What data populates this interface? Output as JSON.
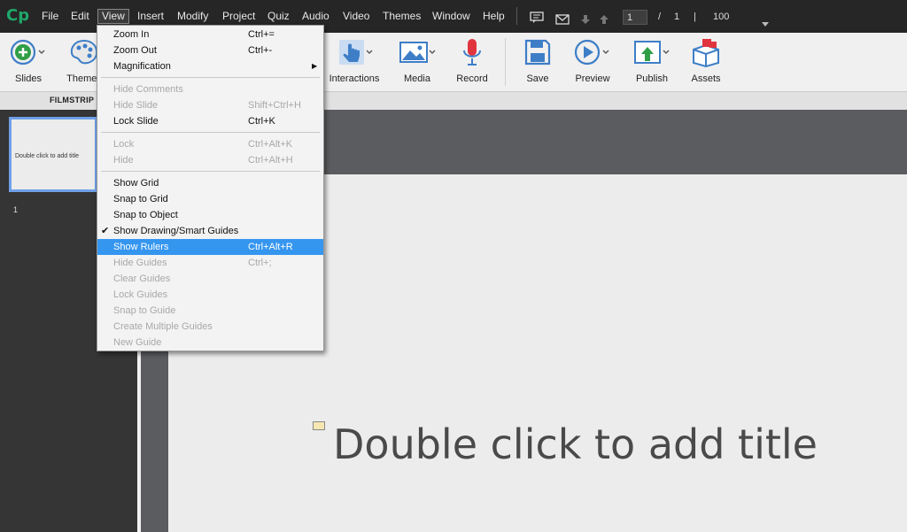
{
  "app": {
    "logo": "Cp"
  },
  "menubar": {
    "items": [
      "File",
      "Edit",
      "View",
      "Insert",
      "Modify",
      "Project",
      "Quiz",
      "Audio",
      "Video",
      "Themes",
      "Window",
      "Help"
    ],
    "page_current": "1",
    "page_separator": "/",
    "page_total": "1",
    "zoom_separator": "|",
    "zoom": "100"
  },
  "toolbar": {
    "slides": "Slides",
    "themes": "Themes",
    "interactions": "Interactions",
    "media": "Media",
    "record": "Record",
    "save": "Save",
    "preview": "Preview",
    "publish": "Publish",
    "assets": "Assets"
  },
  "filmstrip": {
    "label": "FILMSTRIP",
    "thumb_text": "Double click to add title",
    "slide_number": "1"
  },
  "slide": {
    "title": "Double click to add title"
  },
  "view_menu": {
    "items": [
      {
        "label": "Zoom In",
        "shortcut": "Ctrl+=",
        "enabled": true
      },
      {
        "label": "Zoom Out",
        "shortcut": "Ctrl+-",
        "enabled": true
      },
      {
        "label": "Magnification",
        "shortcut": "",
        "enabled": true,
        "submenu": true
      },
      {
        "label": "Hide Comments",
        "shortcut": "",
        "enabled": false
      },
      {
        "label": "Hide Slide",
        "shortcut": "Shift+Ctrl+H",
        "enabled": false
      },
      {
        "label": "Lock Slide",
        "shortcut": "Ctrl+K",
        "enabled": true
      },
      {
        "label": "Lock",
        "shortcut": "Ctrl+Alt+K",
        "enabled": false
      },
      {
        "label": "Hide",
        "shortcut": "Ctrl+Alt+H",
        "enabled": false
      },
      {
        "label": "Show Grid",
        "shortcut": "",
        "enabled": true
      },
      {
        "label": "Snap to Grid",
        "shortcut": "",
        "enabled": true
      },
      {
        "label": "Snap to Object",
        "shortcut": "",
        "enabled": true
      },
      {
        "label": "Show Drawing/Smart Guides",
        "shortcut": "",
        "enabled": true,
        "checked": true
      },
      {
        "label": "Show Rulers",
        "shortcut": "Ctrl+Alt+R",
        "enabled": true,
        "highlighted": true
      },
      {
        "label": "Hide Guides",
        "shortcut": "Ctrl+;",
        "enabled": false
      },
      {
        "label": "Clear Guides",
        "shortcut": "",
        "enabled": false
      },
      {
        "label": "Lock Guides",
        "shortcut": "",
        "enabled": false
      },
      {
        "label": "Snap to Guide",
        "shortcut": "",
        "enabled": false
      },
      {
        "label": "Create Multiple Guides",
        "shortcut": "",
        "enabled": false
      },
      {
        "label": "New Guide",
        "shortcut": "",
        "enabled": false
      }
    ]
  },
  "colors": {
    "menubar_bg": "#262626",
    "highlight": "#3596f0",
    "logo": "#1fa86a",
    "thumb_border": "#6f9fe6",
    "toolbar_icon_blue": "#3e7ec7",
    "record_red": "#e0343f",
    "publish_green": "#2f9e46"
  }
}
